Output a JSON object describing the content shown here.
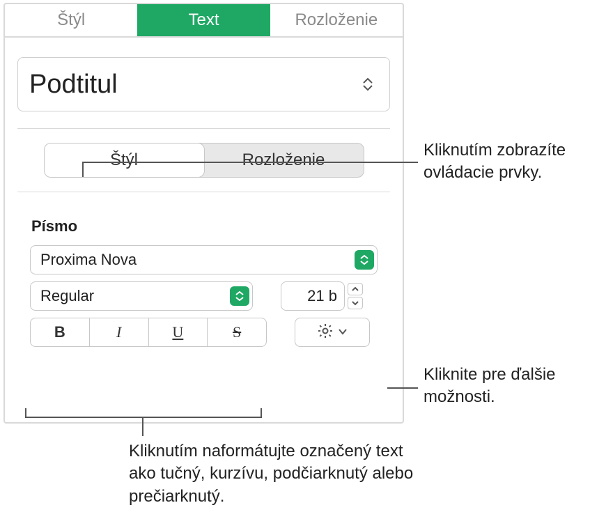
{
  "topTabs": {
    "style": "Štýl",
    "text": "Text",
    "layout": "Rozloženie"
  },
  "paragraphStyle": "Podtitul",
  "subTabs": {
    "style": "Štýl",
    "layout": "Rozloženie"
  },
  "font": {
    "sectionLabel": "Písmo",
    "family": "Proxima Nova",
    "style": "Regular",
    "size": "21 b",
    "bold": "B",
    "italic": "I",
    "underline": "U",
    "strike": "S"
  },
  "callouts": {
    "subTabs": "Kliknutím zobrazíte ovládacie prvky.",
    "gear": "Kliknite pre ďalšie možnosti.",
    "bius": "Kliknutím naformátujte označený text ako tučný, kurzívu, podčiarknutý alebo prečiarknutý."
  }
}
